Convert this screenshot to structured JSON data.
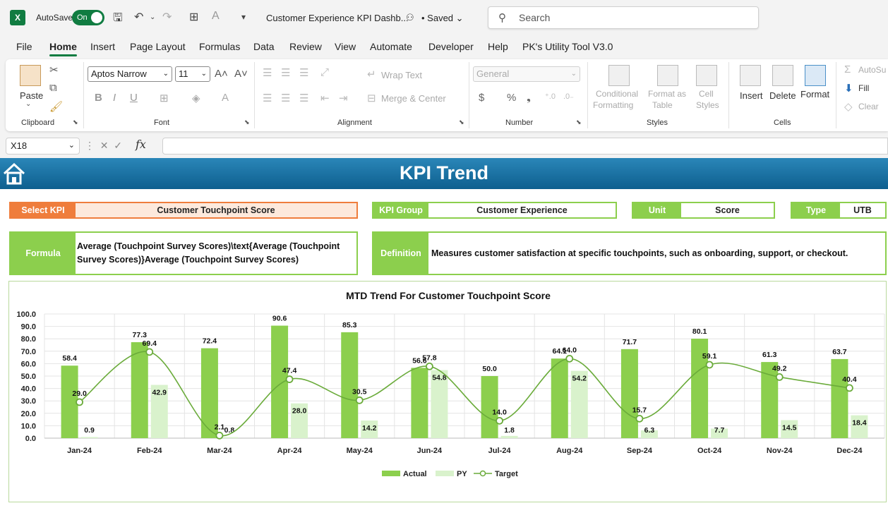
{
  "titlebar": {
    "app_logo": "X",
    "autosave_label": "AutoSave",
    "autosave_state": "On",
    "doc_title": "Customer Experience KPI Dashb...",
    "saved_status": "• Saved",
    "search_placeholder": "Search"
  },
  "menu": {
    "items": [
      "File",
      "Home",
      "Insert",
      "Page Layout",
      "Formulas",
      "Data",
      "Review",
      "View",
      "Automate",
      "Developer",
      "Help",
      "PK's Utility Tool V3.0"
    ],
    "active": "Home"
  },
  "ribbon": {
    "clipboard": {
      "label": "Clipboard",
      "paste": "Paste"
    },
    "font": {
      "label": "Font",
      "font_name": "Aptos Narrow",
      "font_size": "11"
    },
    "alignment": {
      "label": "Alignment",
      "wrap_text": "Wrap Text",
      "merge_center": "Merge & Center"
    },
    "number": {
      "label": "Number",
      "format": "General"
    },
    "styles": {
      "label": "Styles",
      "conditional_1": "Conditional",
      "conditional_2": "Formatting",
      "format_as_1": "Format as",
      "format_as_2": "Table",
      "cell_styles_1": "Cell",
      "cell_styles_2": "Styles"
    },
    "cells": {
      "label": "Cells",
      "insert": "Insert",
      "delete": "Delete",
      "format": "Format"
    },
    "editing": {
      "autosum": "AutoSu",
      "fill": "Fill",
      "clear": "Clear"
    }
  },
  "formula_bar": {
    "name_box": "X18",
    "fx": "fx"
  },
  "dashboard": {
    "title": "KPI Trend",
    "select_kpi_label": "Select KPI",
    "select_kpi_value": "Customer Touchpoint Score",
    "kpi_group_label": "KPI Group",
    "kpi_group_value": "Customer Experience",
    "unit_label": "Unit",
    "unit_value": "Score",
    "type_label": "Type",
    "type_value": "UTB",
    "formula_label": "Formula",
    "formula_line1": "Average (Touchpoint Survey Scores)\\text{Average (Touchpoint",
    "formula_line2": "Survey Scores)}Average (Touchpoint Survey Scores)",
    "definition_label": "Definition",
    "definition_value": "Measures customer satisfaction at specific touchpoints, such as onboarding, support, or checkout."
  },
  "colors": {
    "banner": "#1a73a6",
    "select_kpi": "#ef7d3c",
    "green_label": "#8ccf4d",
    "actual": "#8ccf4d",
    "py": "#d9f2cc",
    "target": "#6aab3a"
  },
  "chart_data": {
    "type": "bar",
    "title": "MTD Trend For Customer Touchpoint Score",
    "categories": [
      "Jan-24",
      "Feb-24",
      "Mar-24",
      "Apr-24",
      "May-24",
      "Jun-24",
      "Jul-24",
      "Aug-24",
      "Sep-24",
      "Oct-24",
      "Nov-24",
      "Dec-24"
    ],
    "series": [
      {
        "name": "Actual",
        "type": "bar",
        "values": [
          58.4,
          77.3,
          72.4,
          90.6,
          85.3,
          56.6,
          50.0,
          64.1,
          71.7,
          80.1,
          61.3,
          63.7
        ]
      },
      {
        "name": "PY",
        "type": "bar",
        "values": [
          0.9,
          42.9,
          0.8,
          28.0,
          14.2,
          54.8,
          1.8,
          54.2,
          6.3,
          7.7,
          14.5,
          18.4
        ]
      },
      {
        "name": "Target",
        "type": "line",
        "values": [
          29.0,
          69.4,
          2.1,
          47.4,
          30.5,
          57.8,
          14.0,
          64.0,
          15.7,
          59.1,
          49.2,
          40.4
        ]
      }
    ],
    "ylim": [
      0,
      100
    ],
    "yticks": [
      "0.0",
      "10.0",
      "20.0",
      "30.0",
      "40.0",
      "50.0",
      "60.0",
      "70.0",
      "80.0",
      "90.0",
      "100.0"
    ],
    "grid": true,
    "legend": "bottom"
  }
}
